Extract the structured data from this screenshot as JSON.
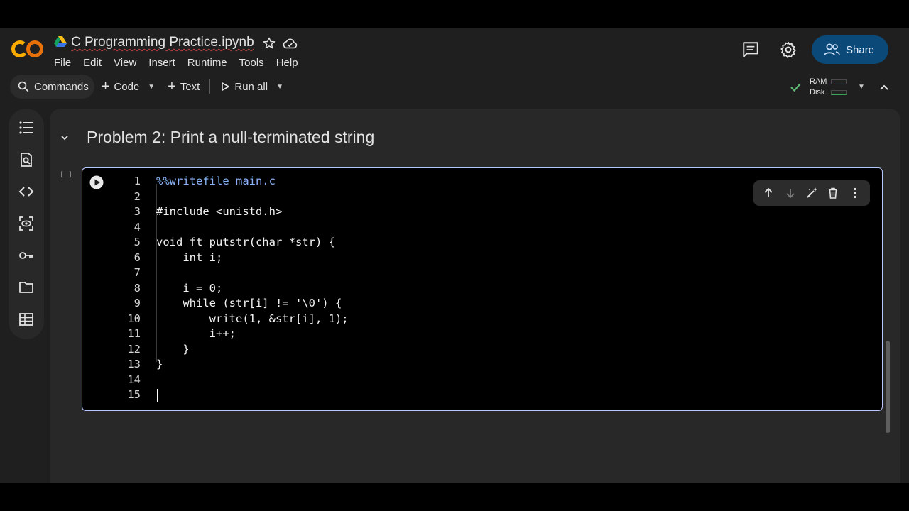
{
  "header": {
    "logo_text": "CO",
    "notebook_title": "C Programming Practice.ipynb",
    "menu": [
      "File",
      "Edit",
      "View",
      "Insert",
      "Runtime",
      "Tools",
      "Help"
    ],
    "share_label": "Share"
  },
  "toolbar": {
    "commands_label": "Commands",
    "code_label": "Code",
    "text_label": "Text",
    "run_all_label": "Run all",
    "ram_label": "RAM",
    "disk_label": "Disk"
  },
  "rail_icons": [
    "table-of-contents-icon",
    "find-replace-icon",
    "code-snippets-icon",
    "variables-icon",
    "secrets-key-icon",
    "files-folder-icon",
    "data-table-icon"
  ],
  "section": {
    "title": "Problem 2: Print a null-terminated string"
  },
  "cell": {
    "execution_count": "[ ]",
    "lines": [
      {
        "n": "1",
        "text": "%%writefile main.c"
      },
      {
        "n": "2",
        "text": ""
      },
      {
        "n": "3",
        "text": "#include <unistd.h>"
      },
      {
        "n": "4",
        "text": ""
      },
      {
        "n": "5",
        "text": "void ft_putstr(char *str) {"
      },
      {
        "n": "6",
        "text": "    int i;"
      },
      {
        "n": "7",
        "text": ""
      },
      {
        "n": "8",
        "text": "    i = 0;"
      },
      {
        "n": "9",
        "text": "    while (str[i] != '\\0') {"
      },
      {
        "n": "10",
        "text": "        write(1, &str[i], 1);"
      },
      {
        "n": "11",
        "text": "        i++;"
      },
      {
        "n": "12",
        "text": "    }"
      },
      {
        "n": "13",
        "text": "}"
      },
      {
        "n": "14",
        "text": ""
      },
      {
        "n": "15",
        "text": ""
      }
    ]
  },
  "colors": {
    "background": "#1f1f1f",
    "panel": "#282828",
    "accent": "#0b4a78",
    "cell_border": "#b8c7ff",
    "magic_keyword": "#8ab4f8",
    "status_ok": "#5bb974"
  }
}
